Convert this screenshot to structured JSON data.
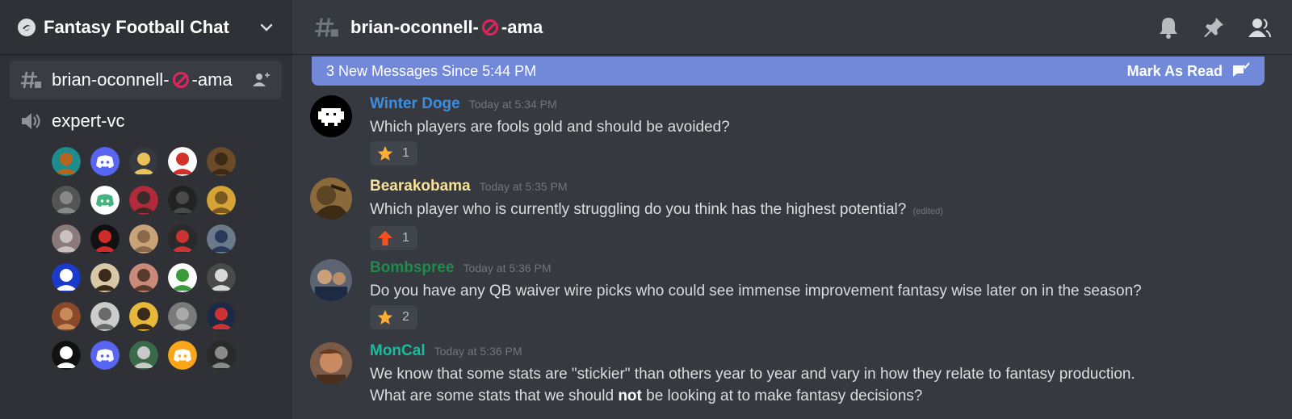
{
  "server": {
    "name": "Fantasy Football Chat"
  },
  "sidebar": {
    "channels": [
      {
        "name": "brian-oconnell-",
        "suffix": "-ama",
        "type": "text",
        "active": true
      },
      {
        "name": "expert-vc",
        "type": "voice",
        "active": false
      }
    ],
    "voice_member_count": 30
  },
  "header": {
    "channel_name": "brian-oconnell-",
    "channel_suffix": "-ama"
  },
  "new_messages_bar": {
    "text": "3 New Messages Since 5:44 PM",
    "action": "Mark As Read"
  },
  "messages": [
    {
      "author": "Winter Doge",
      "author_color": "#3d8ee0",
      "time": "Today at 5:34 PM",
      "text": "Which players are fools gold and should be avoided?",
      "reaction": {
        "emoji": "star-icon",
        "count": "1"
      }
    },
    {
      "author": "Bearakobama",
      "author_color": "#f8e39a",
      "time": "Today at 5:35 PM",
      "text": "Which player who is currently struggling do you think has the highest potential?",
      "edited": "(edited)",
      "reaction": {
        "emoji": "up-arrow-icon",
        "count": "1"
      }
    },
    {
      "author": "Bombspree",
      "author_color": "#1f8b4c",
      "time": "Today at 5:36 PM",
      "text": "Do you have any QB waiver wire picks who could see immense improvement fantasy wise later on in the season?",
      "reaction": {
        "emoji": "star-icon",
        "count": "2"
      }
    },
    {
      "author": "MonCal",
      "author_color": "#1abc9c",
      "time": "Today at 5:36 PM",
      "text_line1": "We know that some stats are \"stickier\" than others year to year and vary in how they relate to fantasy production.",
      "text_line2_pre": "What are some stats that we should ",
      "text_line2_bold": "not",
      "text_line2_post": " be looking at to make fantasy decisions?"
    }
  ],
  "colors": {
    "accent": "#7289da",
    "background": "#36393f",
    "sidebar": "#2f3136"
  }
}
